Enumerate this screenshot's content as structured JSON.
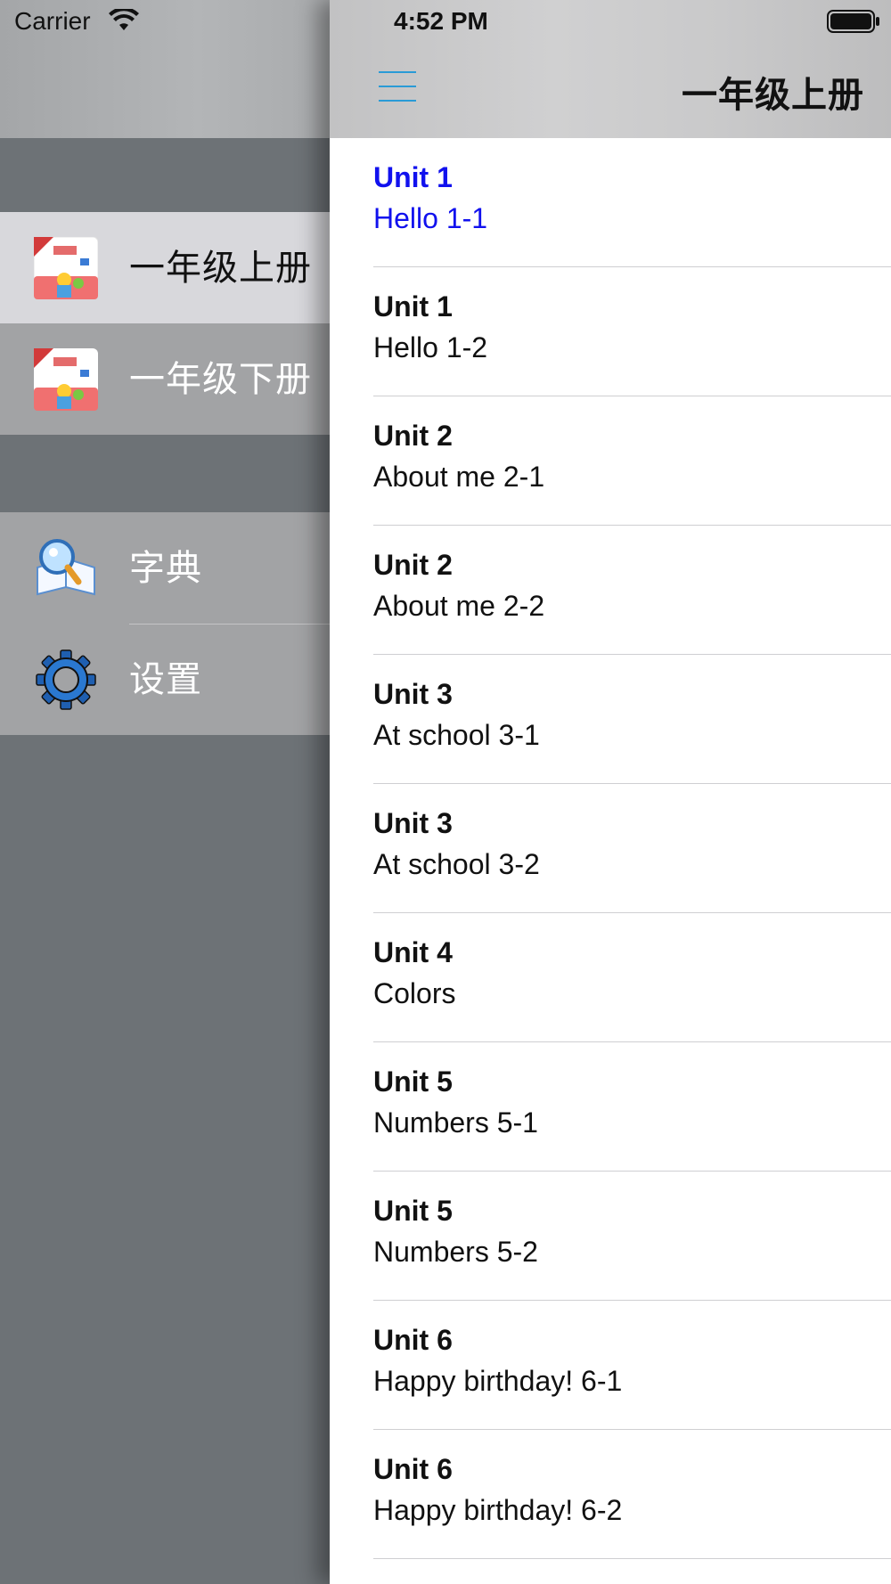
{
  "status_bar": {
    "carrier": "Carrier",
    "time": "4:52 PM"
  },
  "sidebar": {
    "books": [
      {
        "label": "一年级上册",
        "icon": "textbook-cover-icon",
        "selected": true
      },
      {
        "label": "一年级下册",
        "icon": "textbook-cover-icon",
        "selected": false
      }
    ],
    "tools": [
      {
        "label": "字典",
        "icon": "dictionary-magnifier-icon"
      },
      {
        "label": "设置",
        "icon": "gear-icon"
      }
    ]
  },
  "nav": {
    "title": "一年级上册",
    "menu_icon": "hamburger-menu-icon"
  },
  "lessons": [
    {
      "unit": "Unit 1",
      "title": "Hello 1-1",
      "active": true
    },
    {
      "unit": "Unit 1",
      "title": "Hello 1-2"
    },
    {
      "unit": "Unit 2",
      "title": "About me 2-1"
    },
    {
      "unit": "Unit 2",
      "title": "About me 2-2"
    },
    {
      "unit": "Unit 3",
      "title": "At school 3-1"
    },
    {
      "unit": "Unit 3",
      "title": "At school 3-2"
    },
    {
      "unit": "Unit 4",
      "title": "Colors"
    },
    {
      "unit": "Unit 5",
      "title": "Numbers 5-1"
    },
    {
      "unit": "Unit 5",
      "title": "Numbers 5-2"
    },
    {
      "unit": "Unit 6",
      "title": "Happy birthday! 6-1"
    },
    {
      "unit": "Unit 6",
      "title": "Happy birthday! 6-2"
    }
  ],
  "colors": {
    "active_text": "#1111ee",
    "accent_icon": "#2a9bd6",
    "sidebar_bg": "#6d7276",
    "menu_group_bg": "#a2a3a5",
    "selected_row_bg": "#d8d8dc"
  }
}
